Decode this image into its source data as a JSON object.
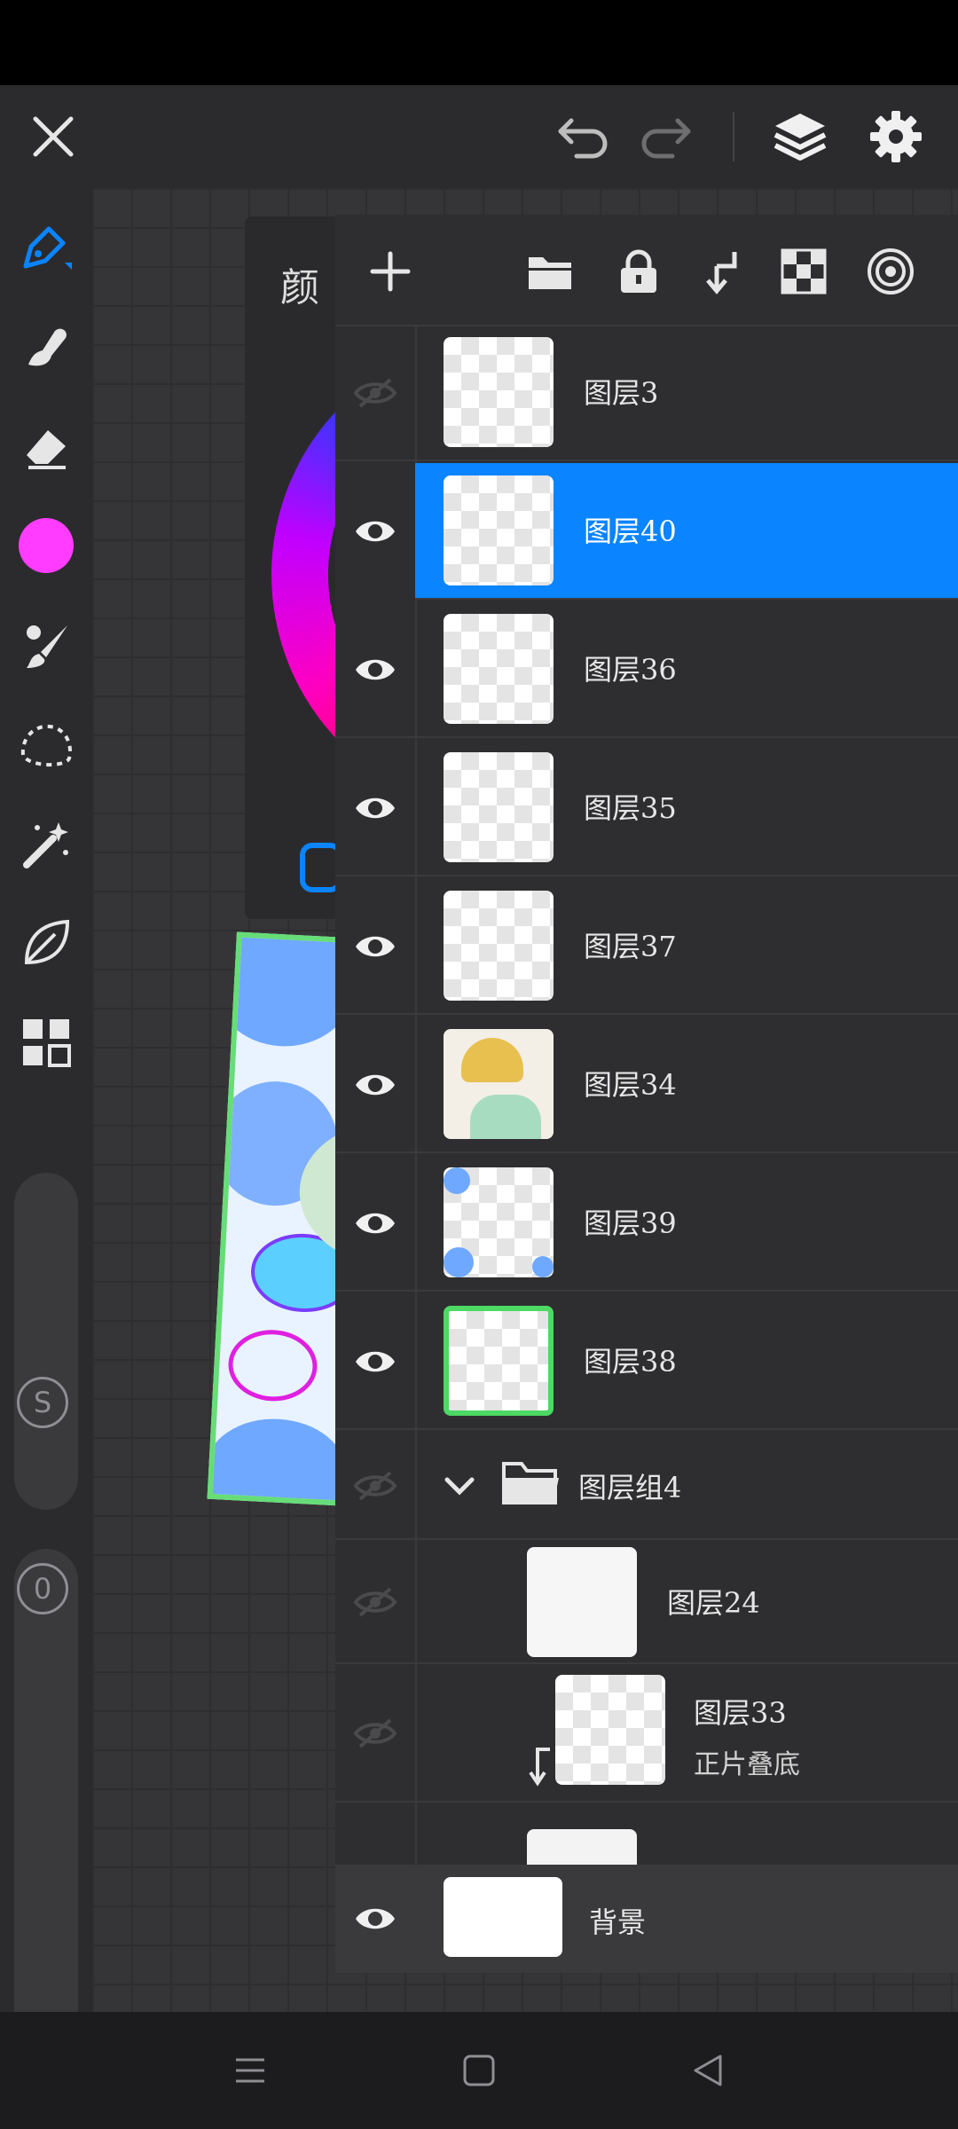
{
  "layers_panel": {
    "layers": [
      {
        "name": "图层3",
        "visible": false
      },
      {
        "name": "图层40",
        "visible": true,
        "selected": true
      },
      {
        "name": "图层36",
        "visible": true
      },
      {
        "name": "图层35",
        "visible": true
      },
      {
        "name": "图层37",
        "visible": true
      },
      {
        "name": "图层34",
        "visible": true
      },
      {
        "name": "图层39",
        "visible": true
      },
      {
        "name": "图层38",
        "visible": true
      }
    ],
    "group": {
      "name": "图层组4",
      "visible": false,
      "expanded": true
    },
    "group_layers": [
      {
        "name": "图层24",
        "visible": false
      },
      {
        "name": "图层33",
        "blend_mode": "正片叠底",
        "visible": false
      }
    ],
    "background": {
      "name": "背景",
      "visible": true
    }
  },
  "color_panel": {
    "title": "颜"
  },
  "current_color": "#ff3cff",
  "accent_color": "#0a84ff"
}
